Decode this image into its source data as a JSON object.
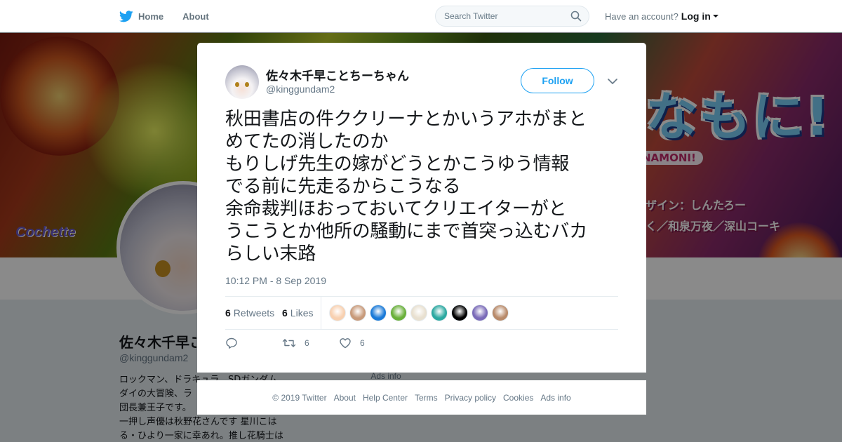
{
  "nav": {
    "home_label": "Home",
    "about_label": "About",
    "search_placeholder": "Search Twitter",
    "account_prompt": "Have an account?",
    "login_label": "Log in"
  },
  "banner": {
    "logo_text": "なもに!",
    "logo_sub": "NAMONI!",
    "credit_line1": "ザイン：しんたろー",
    "credit_line2": "く／和泉万夜／深山コーキ",
    "brand": "Cochette"
  },
  "profile": {
    "name": "佐々木千早ことちーちゃん",
    "handle": "@kinggundam2",
    "bio_lines": [
      "ロックマン、ドラキュラ、SDガンダム",
      "ダイの大冒険、ラ",
      "団長兼王子です。",
      "一押し声優は秋野花さんです 星川こは",
      "る・ひより一家に幸あれ。推し花騎士は"
    ],
    "ads_info": "Ads info"
  },
  "tweet": {
    "author_name": "佐々木千早ことちーちゃん",
    "author_handle": "@kinggundam2",
    "follow_label": "Follow",
    "text_lines": [
      "秋田書店の件ククリーナとかいうアホがまと",
      "めてたの消したのか",
      "もりしげ先生の嫁がどうとかこうゆう情報",
      "でる前に先走るからこうなる",
      "余命裁判ほおっておいてクリエイターがと",
      "うこうとか他所の騒動にまで首突っ込むバカ",
      "らしい末路"
    ],
    "timestamp": "10:12 PM - 8 Sep 2019",
    "retweets_count": "6",
    "retweets_label": "Retweets",
    "likes_count": "6",
    "likes_label": "Likes",
    "liker_avatar_colors": [
      "#f8d0b0",
      "#c89a7a",
      "#1a7ad8",
      "#6ab03a",
      "#e8e0d0",
      "#2aa8a0",
      "#000000",
      "#7a6ab8",
      "#b88a6a"
    ],
    "action_retweet_count": "6",
    "action_like_count": "6"
  },
  "footer": {
    "links": [
      "© 2019 Twitter",
      "About",
      "Help Center",
      "Terms",
      "Privacy policy",
      "Cookies",
      "Ads info"
    ]
  },
  "colors": {
    "twitter_blue": "#1da1f2",
    "text_primary": "#14171a",
    "text_secondary": "#657786",
    "overlay": "rgba(0,0,0,0.46)"
  },
  "icons": {
    "logo": "twitter-bird-icon",
    "search": "search-icon",
    "close": "close-icon",
    "more": "chevron-down-icon",
    "reply": "reply-icon",
    "retweet": "retweet-icon",
    "like": "heart-icon"
  }
}
